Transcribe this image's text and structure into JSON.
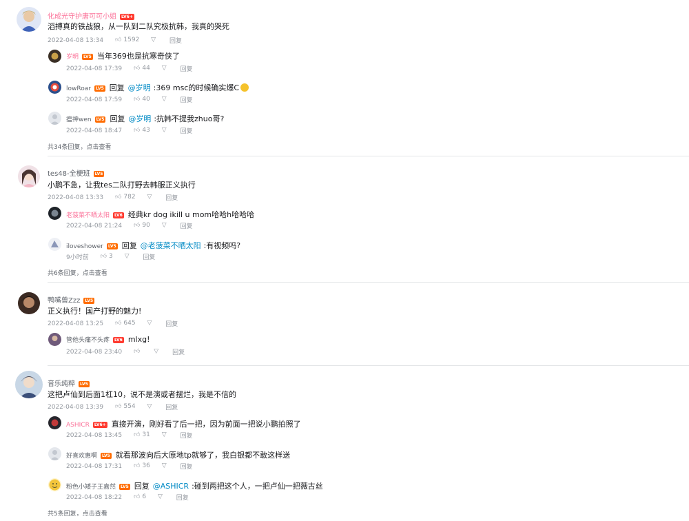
{
  "comments": [
    {
      "user": "化成光守护唐可可小姐",
      "level": "LV6+",
      "text": "滔搏真的铁战狼，从一队到二队究极抗韩，我真的哭死",
      "date": "2022-04-08 13:34",
      "likes": "1592",
      "reply_label": "回复",
      "replies": [
        {
          "user": "岁明",
          "level": "LV5",
          "text": "当年369也是抗寒奇侠了",
          "date": "2022-04-08 17:39",
          "likes": "44",
          "reply_label": "回复"
        },
        {
          "user": "lowRoar",
          "level": "LV5",
          "prefix": "回复",
          "mention": "@岁明",
          "text": ":369 msc的时候确实爆C",
          "date": "2022-04-08 17:59",
          "likes": "40",
          "reply_label": "回复"
        },
        {
          "user": "瘟神wen",
          "level": "LV5",
          "prefix": "回复",
          "mention": "@岁明",
          "text": ":抗韩不提我zhuo哥?",
          "date": "2022-04-08 18:47",
          "likes": "43",
          "reply_label": "回复"
        }
      ],
      "more": "共34条回复，点击查看"
    },
    {
      "user": "tes48-全梗班",
      "level": "LV5",
      "text": "小鹏不急，让我tes二队打野去韩服正义执行",
      "date": "2022-04-08 13:33",
      "likes": "782",
      "reply_label": "回复",
      "replies": [
        {
          "user": "老菠菜不晒太阳",
          "level": "LV6",
          "text": "经典kr dog ikill u mom哈哈h哈哈哈",
          "date": "2022-04-08 21:24",
          "likes": "90",
          "reply_label": "回复"
        },
        {
          "user": "iloveshower",
          "level": "LV5",
          "prefix": "回复",
          "mention": "@老菠菜不晒太阳",
          "text": ":有视频吗?",
          "date": "9小时前",
          "likes": "3",
          "reply_label": "回复"
        }
      ],
      "more": "共6条回复，点击查看"
    },
    {
      "user": "鸭嘴兽Zzz",
      "level": "LV5",
      "text": "正义执行！国产打野的魅力!",
      "date": "2022-04-08 13:25",
      "likes": "645",
      "reply_label": "回复",
      "replies": [
        {
          "user": "管他头痛不头疼",
          "level": "LV6",
          "text": "mlxg!",
          "date": "2022-04-08 23:40",
          "likes": "",
          "reply_label": "回复"
        }
      ],
      "more": ""
    },
    {
      "user": "音乐纯粹",
      "level": "LV5",
      "text": "这把卢仙到后面1杠10，说不是演或者摆烂，我是不信的",
      "date": "2022-04-08 13:39",
      "likes": "554",
      "reply_label": "回复",
      "replies": [
        {
          "user": "ASHICR",
          "level": "LV6+",
          "text": "直接开演，刚好看了后一把，因为前面一把说小鹏拍照了",
          "date": "2022-04-08 13:45",
          "likes": "31",
          "reply_label": "回复"
        },
        {
          "user": "好喜欢惠啊",
          "level": "LV5",
          "text": "就看那波向后大原地tp就够了，我白银都不敢这样送",
          "date": "2022-04-08 17:31",
          "likes": "36",
          "reply_label": "回复"
        },
        {
          "user": "粉色小矮子王嘉然",
          "level": "LV5",
          "prefix": "回复",
          "mention": "@ASHICR",
          "text": ":碰到两把这个人，一把卢仙一把薇古丝",
          "date": "2022-04-08 18:22",
          "likes": "6",
          "reply_label": "回复"
        }
      ],
      "more": "共5条回复，点击查看"
    }
  ],
  "icons": {
    "like": "thumb-up-icon",
    "reply": "reply-bubble-icon"
  },
  "colors": {
    "username": "#61666d",
    "vip_username": "#fb7299",
    "mention": "#008ac5",
    "meta": "#9499a0",
    "level_badge": "#f26b4c"
  }
}
